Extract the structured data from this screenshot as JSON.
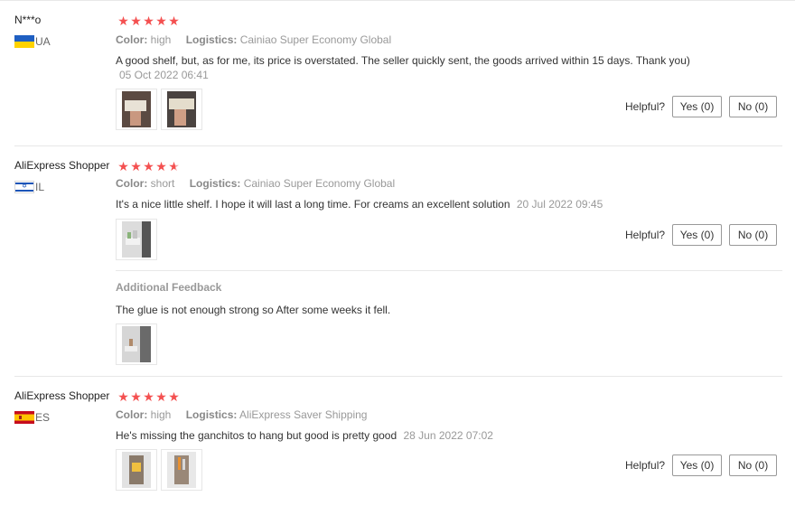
{
  "labels": {
    "color": "Color:",
    "logistics": "Logistics:",
    "helpful": "Helpful?",
    "additional_feedback": "Additional Feedback"
  },
  "reviews": [
    {
      "user": "N***o",
      "country": "UA",
      "rating": 5,
      "color": "high",
      "logistics": "Cainiao Super Economy Global",
      "text": "A good shelf, but, as for me, its price is overstated. The seller quickly sent, the goods arrived within 15 days. Thank you)",
      "date": "05 Oct 2022 06:41",
      "helpful_yes": "Yes (0)",
      "helpful_no": "No (0)",
      "images": 2
    },
    {
      "user": "AliExpress Shopper",
      "country": "IL",
      "rating": 4.5,
      "color": "short",
      "logistics": "Cainiao Super Economy Global",
      "text": "It's a nice little shelf. I hope it will last a long time. For creams an excellent solution",
      "date": "20 Jul 2022 09:45",
      "helpful_yes": "Yes (0)",
      "helpful_no": "No (0)",
      "images": 1,
      "additional_feedback": {
        "text": "The glue is not enough strong so After some weeks it fell.",
        "images": 1
      }
    },
    {
      "user": "AliExpress Shopper",
      "country": "ES",
      "rating": 5,
      "color": "high",
      "logistics": "AliExpress Saver Shipping",
      "text": "He's missing the ganchitos to hang but good is pretty good",
      "date": "28 Jun 2022 07:02",
      "helpful_yes": "Yes (0)",
      "helpful_no": "No (0)",
      "images": 2
    }
  ],
  "colors": {
    "star": "#f45050",
    "muted": "#999999",
    "divider": "#e8e8e8"
  }
}
